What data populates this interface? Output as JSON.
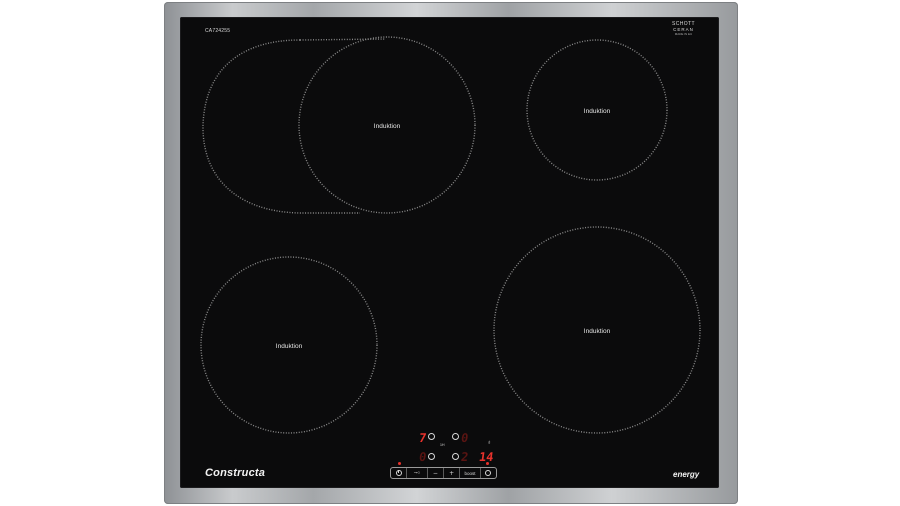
{
  "model_number": "CA724255",
  "glass_brand": {
    "line1": "SCHOTT",
    "line2": "CERAN",
    "line3": "MADE IN EU"
  },
  "brand": "Constructa",
  "energy_label": "energy",
  "zones": [
    {
      "id": "front-left-back-flex",
      "label": "Induktion"
    },
    {
      "id": "rear-right",
      "label": "Induktion"
    },
    {
      "id": "front-left",
      "label": "Induktion"
    },
    {
      "id": "front-right",
      "label": "Induktion"
    }
  ],
  "displays": {
    "top_left_digit": "7",
    "top_left_small": "1H",
    "top_right_digit": "0",
    "bottom_left_digit": "0",
    "bottom_right_digit": "2",
    "timer_value": "14"
  },
  "controls": {
    "power_icon": "power-icon",
    "lock_label": "⊸○",
    "minus_label": "−",
    "plus_label": "+",
    "boost_label": "boost",
    "timer_icon": "timer-icon"
  },
  "colors": {
    "glass": "#0b0b0c",
    "display_red": "#e8322c"
  }
}
